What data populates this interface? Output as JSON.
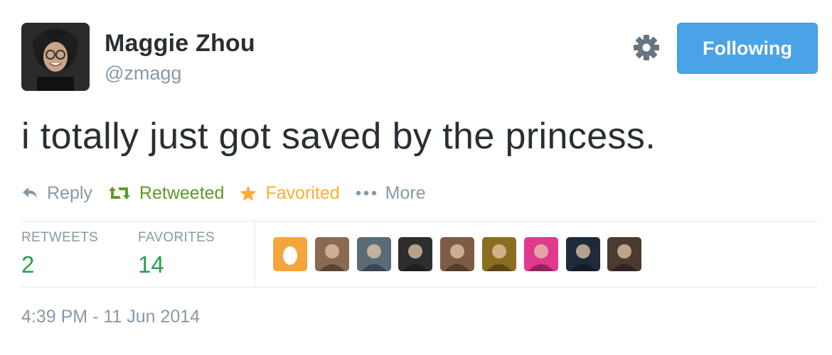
{
  "user": {
    "display_name": "Maggie Zhou",
    "handle": "@zmagg"
  },
  "follow_button": {
    "label": "Following"
  },
  "tweet": {
    "text": "i totally just got saved by the princess."
  },
  "actions": {
    "reply": "Reply",
    "retweet": "Retweeted",
    "favorite": "Favorited",
    "more": "More"
  },
  "stats": {
    "retweets_label": "RETWEETS",
    "retweets_count": "2",
    "favorites_label": "FAVORITES",
    "favorites_count": "14"
  },
  "favoriters": [
    {
      "icon": "default-egg-avatar",
      "color": "#f5a53b"
    },
    {
      "icon": "user-avatar",
      "color": "#8a6a52"
    },
    {
      "icon": "user-avatar",
      "color": "#5a6b78"
    },
    {
      "icon": "user-avatar",
      "color": "#2e2e2e"
    },
    {
      "icon": "user-avatar",
      "color": "#7d5b45"
    },
    {
      "icon": "user-avatar",
      "color": "#8b6d1f"
    },
    {
      "icon": "user-avatar",
      "color": "#e0398f"
    },
    {
      "icon": "user-avatar",
      "color": "#1f2a3a"
    },
    {
      "icon": "user-avatar",
      "color": "#4a3a30"
    }
  ],
  "timestamp": "4:39 PM - 11 Jun 2014",
  "colors": {
    "follow_button": "#4aa3e7",
    "retweeted": "#609928",
    "favorited": "#ffac33",
    "stat_count": "#289e4d",
    "muted": "#8899a6"
  }
}
